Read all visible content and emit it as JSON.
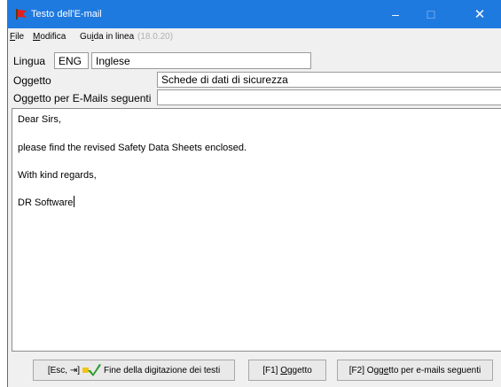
{
  "window": {
    "title": "Testo dell'E-mail",
    "controls": {
      "minimize": "–",
      "maximize": "□",
      "close": "✕"
    }
  },
  "menubar": {
    "file": {
      "accel": "F",
      "rest": "ile"
    },
    "modifica": {
      "accel": "M",
      "rest": "odifica"
    },
    "guida": {
      "pre": "Gu",
      "accel": "i",
      "rest": "da in linea"
    },
    "version": "(18.0.20)"
  },
  "form": {
    "lingua_label": "Lingua",
    "lingua_code": "ENG",
    "lingua_name": "Inglese",
    "oggetto_label": "Oggetto",
    "oggetto_value": "Schede di dati di sicurezza",
    "oggetto_seguenti_label": "Oggetto per E-Mails seguenti",
    "oggetto_seguenti_value": ""
  },
  "body_lines": [
    "Dear Sirs,",
    "please find the revised Safety Data Sheets enclosed.",
    "With kind regards,",
    "DR Software"
  ],
  "buttons": {
    "finish_prefix": "[Esc, ⇥]",
    "finish_label": "Fine della digitazione dei testi",
    "f1_key": "[F1]",
    "f1_label": {
      "accel": "O",
      "rest": "ggetto"
    },
    "f2_key": "[F2]",
    "f2_label": {
      "pre": "Ogg",
      "accel": "e",
      "rest": "tto per e-mails seguenti"
    }
  },
  "colors": {
    "titlebar": "#1f7ae0",
    "window_bg": "#f0f0f0"
  },
  "icons": {
    "app": "flag-icon",
    "finish": "check-icon"
  }
}
